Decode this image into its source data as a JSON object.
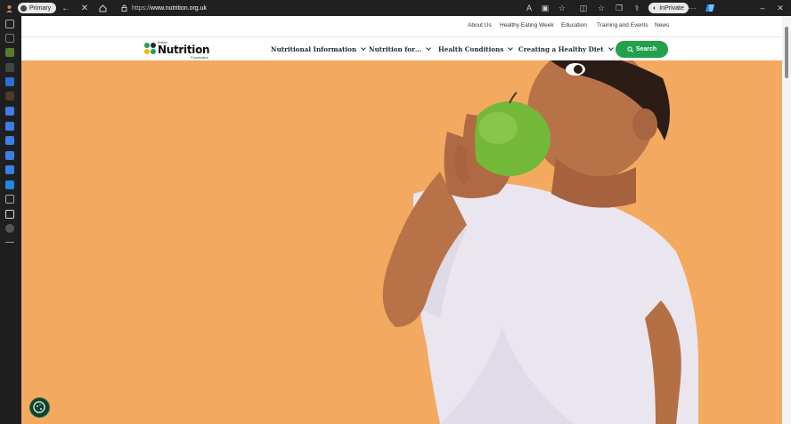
{
  "browser": {
    "profile_label": "Primary",
    "url_prefix": "https://",
    "url_host": "www.nutrition.org.uk",
    "incognito_label": "InPrivate"
  },
  "site": {
    "logo_top": "British",
    "logo_name": "Nutrition",
    "logo_bottom": "Foundation",
    "utility_links": [
      "About Us",
      "Healthy Eating Week",
      "Education",
      "Training and Events",
      "News"
    ],
    "nav_items": [
      "Nutritional Information",
      "Nutrition for…",
      "Health Conditions",
      "Creating a Healthy Diet"
    ],
    "search_label": "Search"
  },
  "colors": {
    "hero_background": "#f4a960",
    "search_button": "#22a04b",
    "cookie_button": "#12402c"
  },
  "icons": {
    "back": "arrow-left-icon",
    "close": "close-icon",
    "home": "home-icon",
    "lock": "lock-icon",
    "search": "search-icon",
    "cookie": "cookie-icon"
  }
}
